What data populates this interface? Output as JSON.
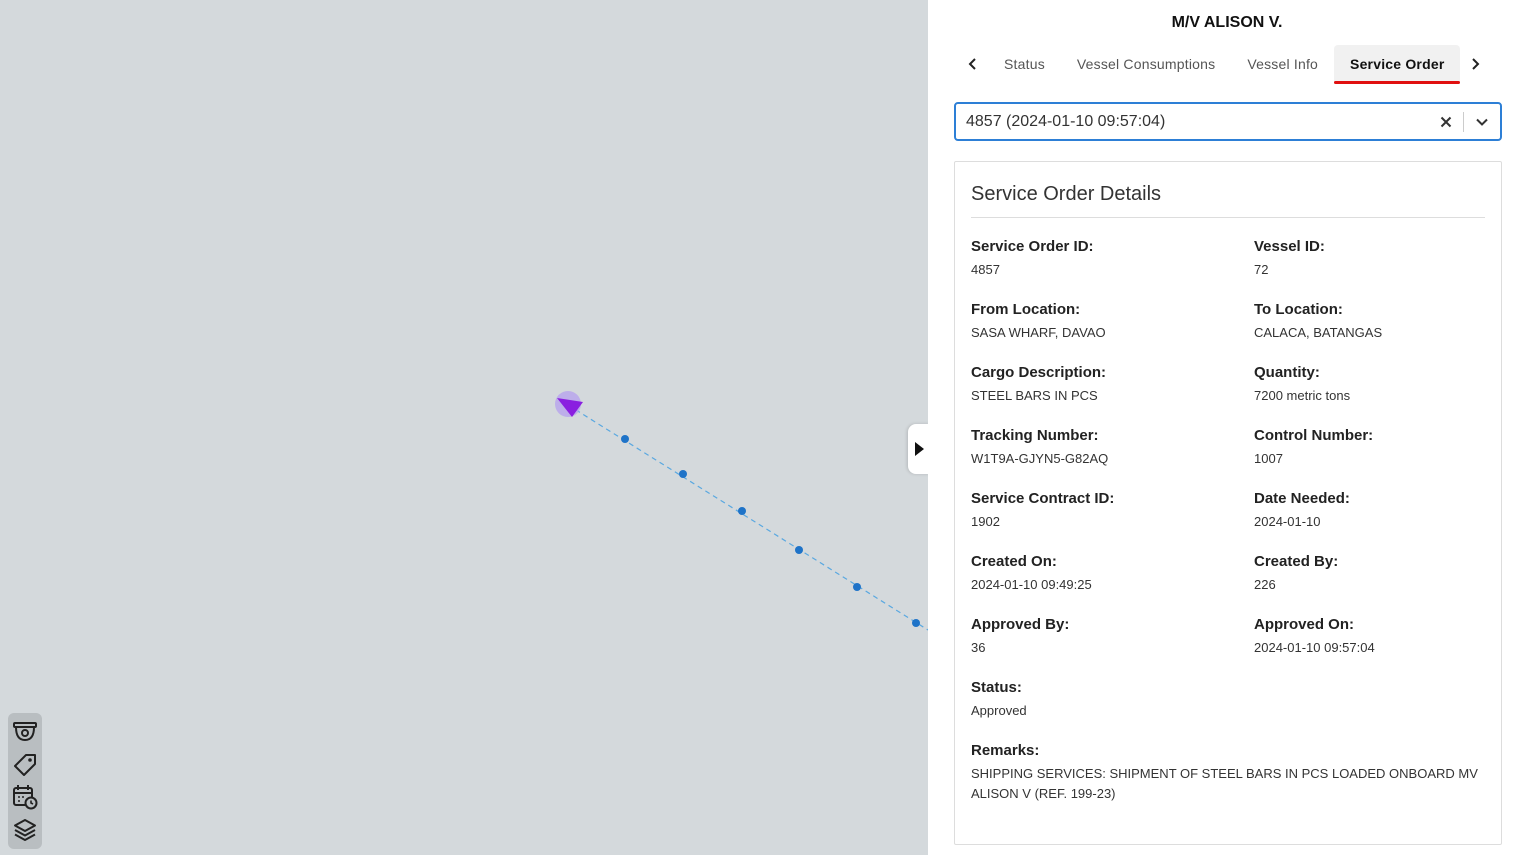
{
  "vessel": {
    "title": "M/V ALISON V."
  },
  "tabs": [
    {
      "label": "Status",
      "active": false
    },
    {
      "label": "Vessel Consumptions",
      "active": false
    },
    {
      "label": "Vessel Info",
      "active": false
    },
    {
      "label": "Service Order",
      "active": true
    }
  ],
  "colors": {
    "accent": "#2d7fd6",
    "active_tab_underline": "#e01010",
    "track": "#1e73c8",
    "vessel_marker": "#8a1fe0"
  },
  "select": {
    "value": "4857 (2024-01-10 09:57:04)"
  },
  "details": {
    "title": "Service Order Details",
    "fields": [
      {
        "label": "Service Order ID:",
        "value": "4857"
      },
      {
        "label": "Vessel ID:",
        "value": "72"
      },
      {
        "label": "From Location:",
        "value": "SASA WHARF, DAVAO"
      },
      {
        "label": "To Location:",
        "value": "CALACA, BATANGAS"
      },
      {
        "label": "Cargo Description:",
        "value": "STEEL BARS IN PCS"
      },
      {
        "label": "Quantity:",
        "value": "7200 metric tons"
      },
      {
        "label": "Tracking Number:",
        "value": "W1T9A-GJYN5-G82AQ"
      },
      {
        "label": "Control Number:",
        "value": "1007"
      },
      {
        "label": "Service Contract ID:",
        "value": "1902"
      },
      {
        "label": "Date Needed:",
        "value": "2024-01-10"
      },
      {
        "label": "Created On:",
        "value": "2024-01-10 09:49:25"
      },
      {
        "label": "Created By:",
        "value": "226"
      },
      {
        "label": "Approved By:",
        "value": "36"
      },
      {
        "label": "Approved On:",
        "value": "2024-01-10 09:57:04"
      },
      {
        "label": "Status:",
        "value": "Approved"
      }
    ],
    "remarks": {
      "label": "Remarks:",
      "value": "SHIPPING SERVICES: SHIPMENT OF STEEL BARS IN PCS LOADED ONBOARD MV ALISON V (REF. 199-23)"
    }
  },
  "map_tools": [
    "cctv-icon",
    "tag-icon",
    "calendar-clock-icon",
    "layers-icon"
  ]
}
